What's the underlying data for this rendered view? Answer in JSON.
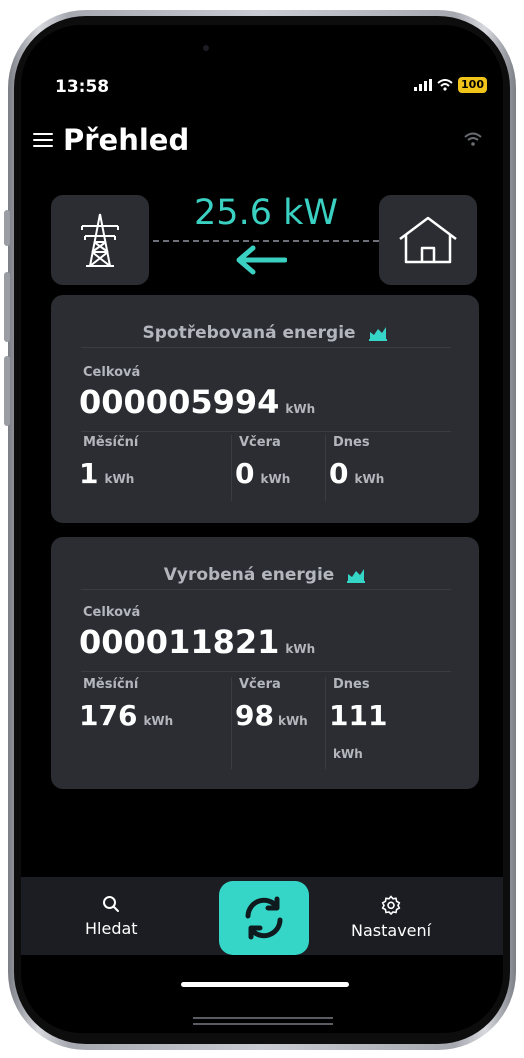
{
  "status_bar": {
    "time": "13:58",
    "battery": "100"
  },
  "header": {
    "title": "Přehled"
  },
  "power_flow": {
    "value": "25.6 kW",
    "direction": "grid-to-home",
    "left_icon": "power-tower-icon",
    "right_icon": "house-icon"
  },
  "consumed": {
    "title": "Spotřebovaná energie",
    "total_label": "Celková",
    "total_value": "000005994",
    "total_unit": "kWh",
    "monthly_label": "Měsíční",
    "monthly_value": "1",
    "monthly_unit": "kWh",
    "yesterday_label": "Včera",
    "yesterday_value": "0",
    "yesterday_unit": "kWh",
    "today_label": "Dnes",
    "today_value": "0",
    "today_unit": "kWh"
  },
  "produced": {
    "title": "Vyrobená energie",
    "total_label": "Celková",
    "total_value": "000011821",
    "total_unit": "kWh",
    "monthly_label": "Měsíční",
    "monthly_value": "176",
    "monthly_unit": "kWh",
    "yesterday_label": "Včera",
    "yesterday_value": "98",
    "yesterday_unit": "kWh",
    "today_label": "Dnes",
    "today_value": "111",
    "today_unit": "kWh"
  },
  "bottom_nav": {
    "search_label": "Hledat",
    "settings_label": "Nastavení"
  },
  "colors": {
    "accent": "#35d6c8",
    "card": "#2b2d33",
    "background": "#000000"
  }
}
